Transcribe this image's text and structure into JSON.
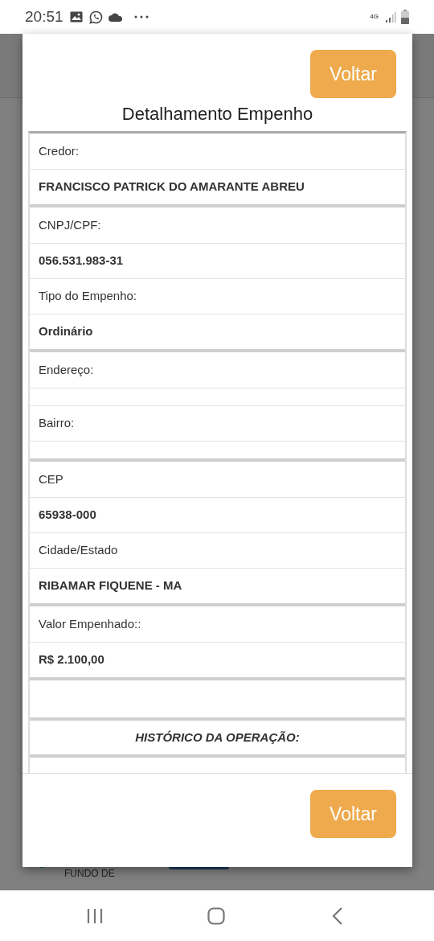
{
  "status_bar": {
    "time": "20:51",
    "network": "4G"
  },
  "background": {
    "item_label_lines": [
      "FUNDO DE"
    ]
  },
  "dialog": {
    "top_button": "Voltar",
    "title": "Detalhamento Empenho",
    "bottom_button": "Voltar",
    "sections": [
      {
        "rows": [
          {
            "kind": "label",
            "text": "Credor:"
          },
          {
            "kind": "value",
            "text": "FRANCISCO PATRICK DO AMARANTE ABREU"
          }
        ]
      },
      {
        "rows": [
          {
            "kind": "label",
            "text": "CNPJ/CPF:"
          },
          {
            "kind": "value",
            "text": "056.531.983-31"
          },
          {
            "kind": "label",
            "text": "Tipo do Empenho:"
          },
          {
            "kind": "value",
            "text": "Ordinário"
          }
        ]
      },
      {
        "rows": [
          {
            "kind": "label",
            "text": "Endereço:"
          },
          {
            "kind": "blank"
          },
          {
            "kind": "label",
            "text": "Bairro:"
          },
          {
            "kind": "blank"
          }
        ]
      },
      {
        "rows": [
          {
            "kind": "label",
            "text": "CEP"
          },
          {
            "kind": "value",
            "text": "65938-000"
          },
          {
            "kind": "label",
            "text": "Cidade/Estado"
          },
          {
            "kind": "value",
            "text": "RIBAMAR FIQUENE - MA"
          }
        ]
      },
      {
        "rows": [
          {
            "kind": "label",
            "text": "Valor Empenhado::"
          },
          {
            "kind": "value",
            "text": "R$ 2.100,00"
          }
        ]
      },
      {
        "rows": [
          {
            "kind": "spacer"
          }
        ]
      },
      {
        "rows": [
          {
            "kind": "heading",
            "text": "HISTÓRICO DA OPERAÇÃO:"
          }
        ]
      },
      {
        "rows": [
          {
            "kind": "blank"
          }
        ]
      }
    ]
  }
}
